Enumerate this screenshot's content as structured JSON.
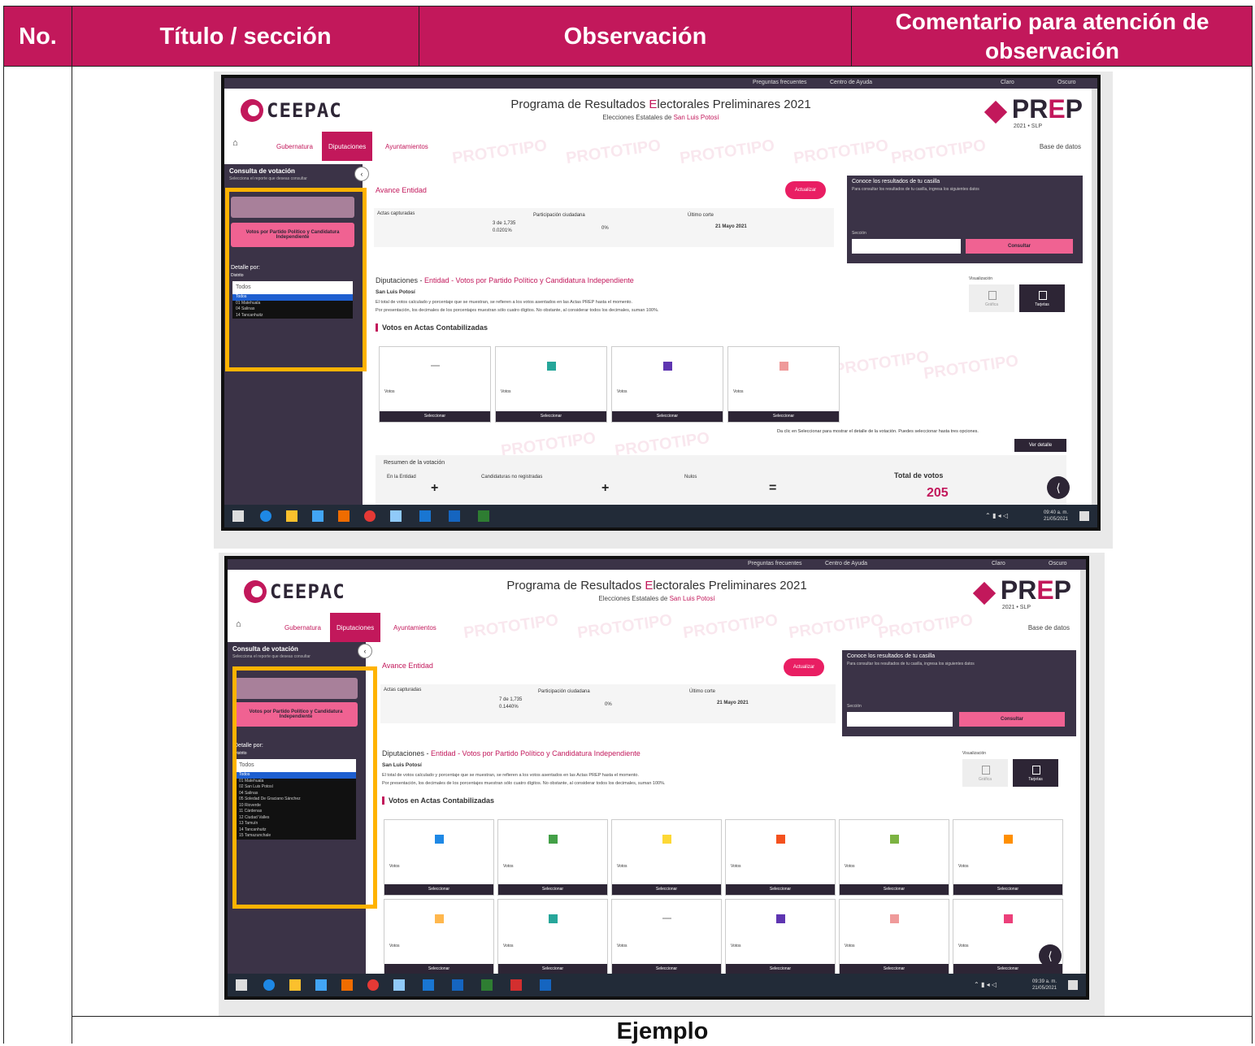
{
  "table": {
    "headers": [
      "No.",
      "Título / sección",
      "Observación",
      "Comentario para atención de observación"
    ],
    "footer_label": "Ejemplo"
  },
  "screenshot_text": {
    "topbar": [
      "Preguntas frecuentes",
      "Centro de Ayuda",
      "Claro",
      "Oscuro"
    ],
    "org_logo": "CEEPAC",
    "title_pre": "Programa de Resultados ",
    "title_hl": "E",
    "title_post": "lectorales Preliminares 2021",
    "subtitle_pre": "Elecciones Estatales de ",
    "subtitle_hl": "San Luis Potosí",
    "prep": {
      "p1": "PR",
      "e": "E",
      "p2": "P",
      "year": "2021 • SLP"
    },
    "home": "Inicio",
    "tabs": [
      "Gubernatura",
      "Diputaciones",
      "Ayuntamientos"
    ],
    "base_datos": "Base de datos",
    "sidebar_title": "Consulta de votación",
    "sidebar_subtitle": "Selecciona el reporte que deseas consultar",
    "sidebar_button": "Votos por Partido Político y Candidatura Independiente",
    "detalle_label": "Detalle por:",
    "distrito_label": "Distrito",
    "select_value": "Todos",
    "avance": "Avance Entidad",
    "actualizar": "Actualizar",
    "actas_label": "Actas capturadas",
    "participacion": "Participación ciudadana",
    "corte": "Último corte",
    "corte_fecha": "21 Mayo 2021",
    "participacion_value": "0%",
    "consulta_casilla": "Conoce los resultados de tu casilla",
    "casilla_hint": "Para consultar los resultados de tu casilla, ingresa los siguientes datos",
    "seccion_label": "Sección",
    "consultar": "Consultar",
    "dip_title_a": "Diputaciones - ",
    "dip_title_b": "Entidad",
    "dip_title_c": " - Votos por Partido Político y Candidatura Independiente",
    "dip_sub": "San Luis Potosí",
    "note_1": "El total de votos calculado y porcentaje que se muestran, se refieren a los votos asentados en las Actas PREP hasta el momento.",
    "note_2": "Por presentación, los decimales de los porcentajes muestran sólo cuatro dígitos. No obstante, al considerar todos los decimales, suman 100%.",
    "votos_actas": "Votos en Actas Contabilizadas",
    "visualizacion": "Visualización",
    "viz_grafica": "Gráfica",
    "viz_tarjetas": "Tarjetas",
    "votos_label": "Votos",
    "seleccionar": "Seleccionar",
    "info_hint": "Da clic en Seleccionar para mostrar el detalle de la votación. Puedes seleccionar hasta tres opciones.",
    "ver_detalle": "Ver detalle",
    "resumen": "Resumen de la votación",
    "res_entidad": "En la Entidad",
    "res_cand": "Candidaturas no registradas",
    "res_nulos": "Nulos",
    "total_label": "Total de votos",
    "total_value": "205",
    "compartir": "Compartir",
    "watermark": "PROTOTIPO",
    "clock_time_1": "09:40 a. m.",
    "clock_time_2": "09:39 a. m.",
    "clock_date": "21/05/2021",
    "options_1": [
      "Todos",
      "01 Matehuala",
      "04 Salinas",
      "14 Tancanhuitz"
    ],
    "options_2": [
      "Todos",
      "01 Matehuala",
      "02 San Luis Potosí",
      "04 Salinas",
      "05 Soledad De Graciano Sánchez",
      "10 Rioverde",
      "11 Cárdenas",
      "12 Ciudad Valles",
      "13 Tamuín",
      "14 Tancanhuitz",
      "15 Tamazunchale"
    ],
    "shot1_actas": "3 de 1,735",
    "shot1_actas_pct": "0.0201%",
    "shot2_actas": "7 de 1,735",
    "shot2_actas_pct": "0.1440%"
  },
  "colors": {
    "header_bg": "#c2185b",
    "highlight_border": "#ffb300",
    "dark_purple": "#3b3347",
    "brand_pink": "#c2185b"
  }
}
